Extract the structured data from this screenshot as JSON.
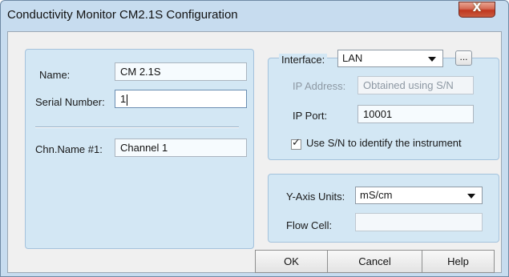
{
  "window": {
    "title": "Conductivity Monitor CM2.1S Configuration",
    "close_glyph": "X"
  },
  "device": {
    "name_label": "Name:",
    "name_value": "CM 2.1S",
    "serial_label": "Serial Number:",
    "serial_value": "1",
    "channel_label": "Chn.Name #1:",
    "channel_value": "Channel 1"
  },
  "interface": {
    "label": "Interface:",
    "selected": "LAN",
    "more_label": "...",
    "ip_address_label": "IP Address:",
    "ip_address_value": "Obtained using S/N",
    "ip_port_label": "IP Port:",
    "ip_port_value": "10001",
    "use_sn_label": "Use S/N to identify the instrument",
    "use_sn_checked": true,
    "check_glyph": "✓"
  },
  "axis": {
    "y_units_label": "Y-Axis Units:",
    "y_units_selected": "mS/cm",
    "flow_cell_label": "Flow Cell:",
    "flow_cell_value": ""
  },
  "buttons": {
    "ok": "OK",
    "cancel": "Cancel",
    "help": "Help"
  }
}
